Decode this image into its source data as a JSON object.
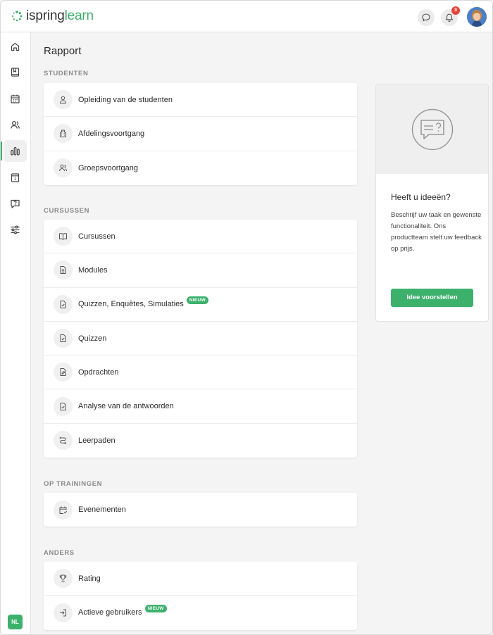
{
  "header": {
    "logo_prefix": "ispring",
    "logo_suffix": "learn",
    "notification_count": "3",
    "brand_color": "#3cb16c"
  },
  "sidebar": {
    "items": [
      {
        "icon": "home-icon"
      },
      {
        "icon": "book-icon"
      },
      {
        "icon": "calendar-icon"
      },
      {
        "icon": "users-icon"
      },
      {
        "icon": "bar-chart-icon",
        "active": true
      },
      {
        "icon": "info-icon"
      },
      {
        "icon": "question-icon"
      },
      {
        "icon": "sliders-icon"
      }
    ],
    "language": "NL"
  },
  "main": {
    "title": "Rapport",
    "sections": [
      {
        "label": "STUDENTEN",
        "items": [
          {
            "label": "Opleiding van de studenten",
            "icon": "user-icon"
          },
          {
            "label": "Afdelingsvoortgang",
            "icon": "building-icon"
          },
          {
            "label": "Groepsvoortgang",
            "icon": "group-icon"
          }
        ]
      },
      {
        "label": "CURSUSSEN",
        "items": [
          {
            "label": "Cursussen",
            "icon": "open-book-icon"
          },
          {
            "label": "Modules",
            "icon": "document-icon"
          },
          {
            "label": "Quizzen, Enquêtes, Simulaties",
            "icon": "checklist-icon",
            "badge": "NIEUW"
          },
          {
            "label": "Quizzen",
            "icon": "checklist-icon"
          },
          {
            "label": "Opdrachten",
            "icon": "edit-document-icon"
          },
          {
            "label": "Analyse van de antwoorden",
            "icon": "checklist-icon"
          },
          {
            "label": "Leerpaden",
            "icon": "path-icon"
          }
        ]
      },
      {
        "label": "OP TRAININGEN",
        "items": [
          {
            "label": "Evenementen",
            "icon": "calendar-check-icon"
          }
        ]
      },
      {
        "label": "ANDERS",
        "items": [
          {
            "label": "Rating",
            "icon": "trophy-icon"
          },
          {
            "label": "Actieve gebruikers",
            "icon": "login-icon",
            "badge": "NIEUW"
          }
        ]
      }
    ]
  },
  "idea_panel": {
    "title": "Heeft u ideeën?",
    "text": "Beschrijf uw taak en gewenste functionaliteit. Ons productteam stelt uw feedback op prijs.",
    "button": "Idee voorstellen",
    "icon": "chat-question-icon"
  }
}
